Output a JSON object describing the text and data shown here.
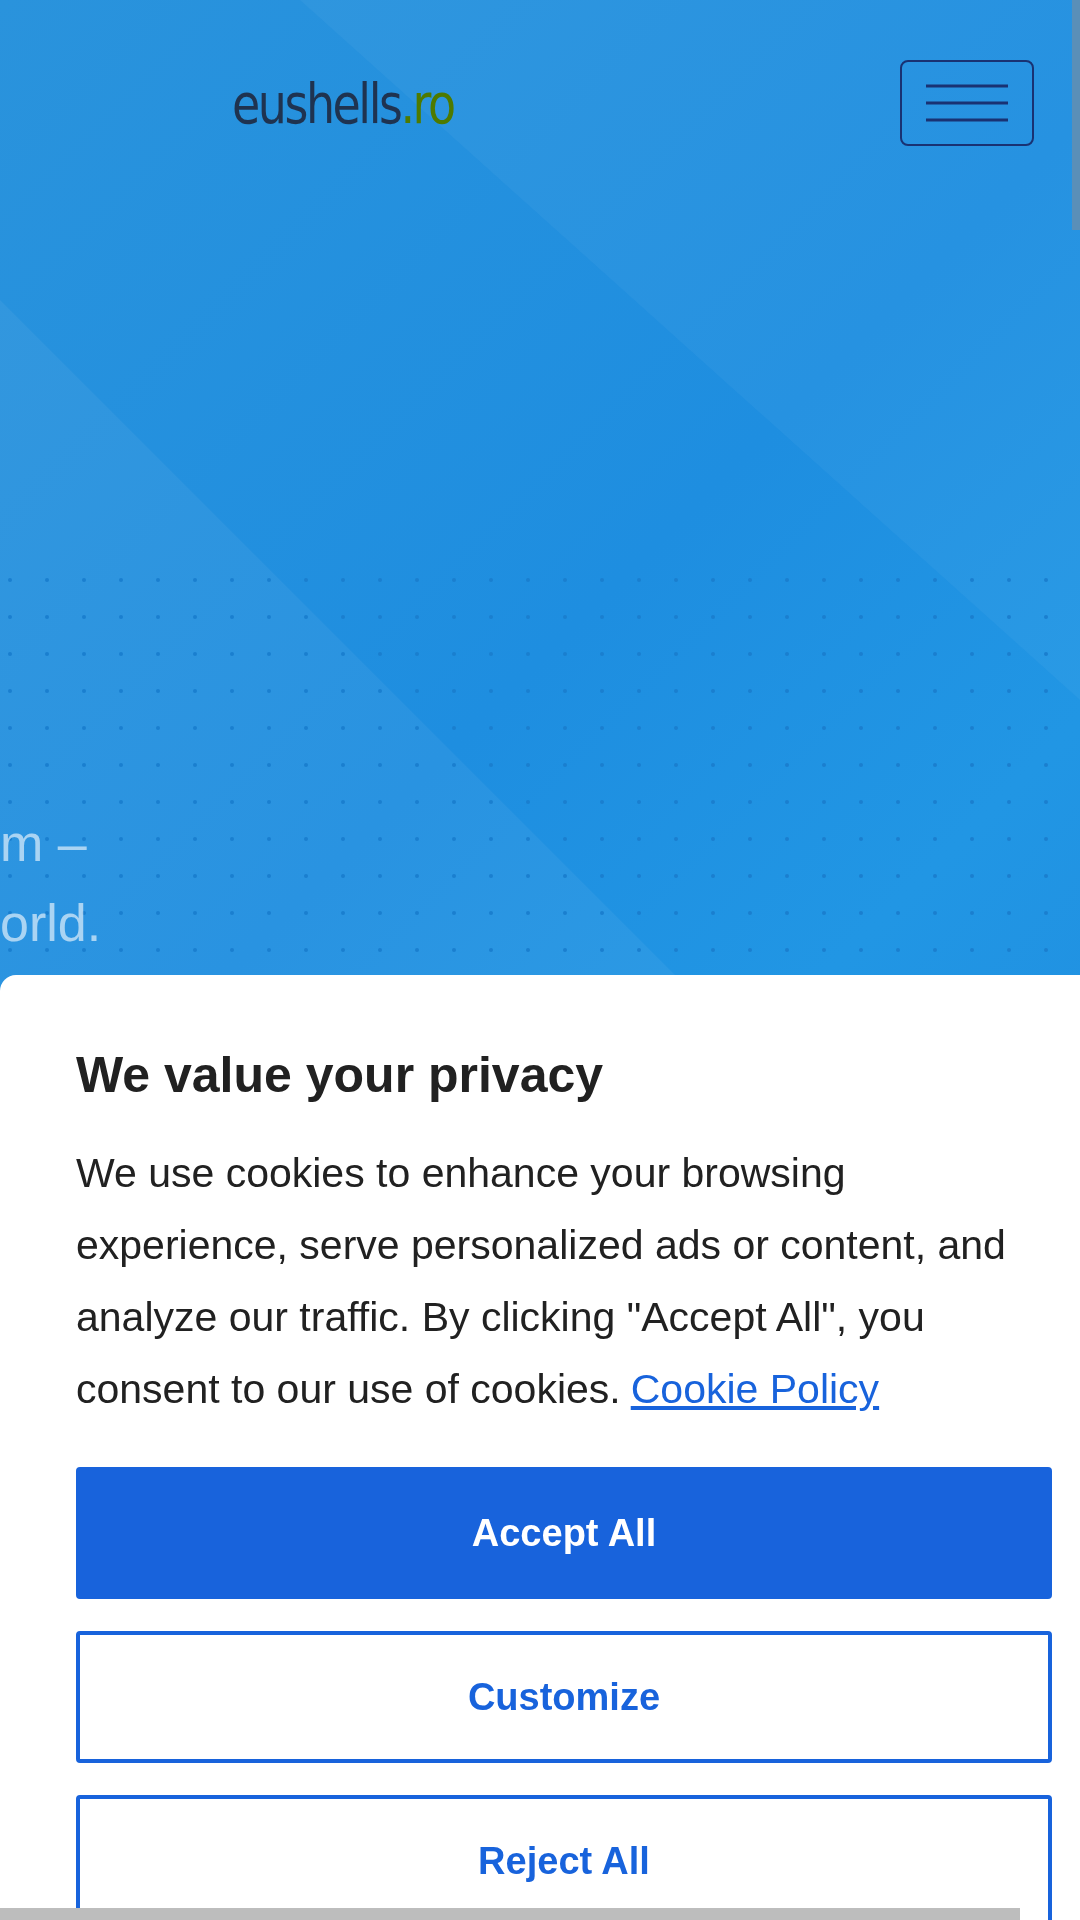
{
  "header": {
    "logo": {
      "name": "eushells",
      "tld": ".ro"
    },
    "menu_button": {
      "kind": "hamburger"
    }
  },
  "hero": {
    "lines": [
      "m –",
      "orld."
    ]
  },
  "cookie_dialog": {
    "title": "We value your privacy",
    "message": "We use cookies to enhance your browsing experience, serve personalized ads or content, and analyze our traffic. By clicking \"Accept All\", you consent to our use of cookies.",
    "link": "Cookie Policy",
    "buttons": [
      {
        "label": "Accept All",
        "kind": "primary"
      },
      {
        "label": "Customize",
        "kind": "outline"
      },
      {
        "label": "Reject All",
        "kind": "outline"
      }
    ]
  }
}
